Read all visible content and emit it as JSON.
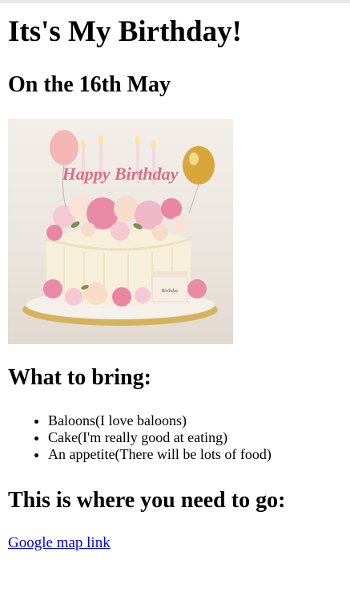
{
  "page": {
    "title": "Its's My Birthday!",
    "date_heading": "On the 16th May",
    "image": {
      "icon": "birthday-cake-image",
      "cake_text": "Happy Birthday",
      "gift_text": "Birthday"
    },
    "bring_heading": "What to bring:",
    "bring_items": [
      "Baloons(I love baloons)",
      "Cake(I'm really good at eating)",
      "An appetite(There will be lots of food)"
    ],
    "where_heading": "This is where you need to go:",
    "map_link_text": "Google map link"
  },
  "colors": {
    "link": "#0000ee",
    "text": "#000000",
    "background": "#ffffff"
  }
}
